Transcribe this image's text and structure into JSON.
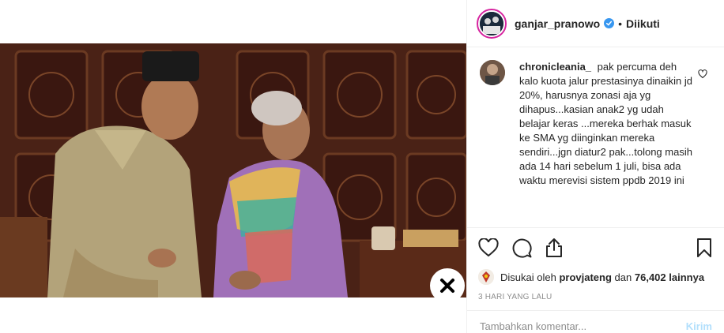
{
  "post": {
    "username": "ganjar_pranowo",
    "verified_icon": "verified-badge-icon",
    "follow_status": "Diikuti",
    "separator": "•"
  },
  "comment": {
    "username": "chronicleania_",
    "text": "pak percuma deh kalo kuota jalur prestasinya dinaikin jd 20%, harusnya zonasi aja yg dihapus...kasian anak2 yg udah belajar keras ...mereka berhak masuk ke SMA yg diinginkan mereka sendiri...jgn diatur2 pak...tolong masih ada 14 hari sebelum 1 juli, bisa ada waktu merevisi sistem ppdb 2019 ini",
    "like_icon": "heart-outline-icon"
  },
  "actions": {
    "like_icon": "heart-icon",
    "comment_icon": "comment-bubble-icon",
    "share_icon": "share-icon",
    "save_icon": "bookmark-icon"
  },
  "likes": {
    "prefix": "Disukai oleh",
    "user": "provjateng",
    "middle": "dan",
    "count": "76,402",
    "suffix": "lainnya"
  },
  "timestamp": "3 HARI YANG LALU",
  "add_comment": {
    "placeholder": "Tambahkan komentar...",
    "post_label": "Kirim"
  },
  "close_icon": "close-x-icon",
  "colors": {
    "verified": "#3897f0",
    "post_button_disabled": "#b2dffc",
    "muted": "#8e8e8e"
  }
}
